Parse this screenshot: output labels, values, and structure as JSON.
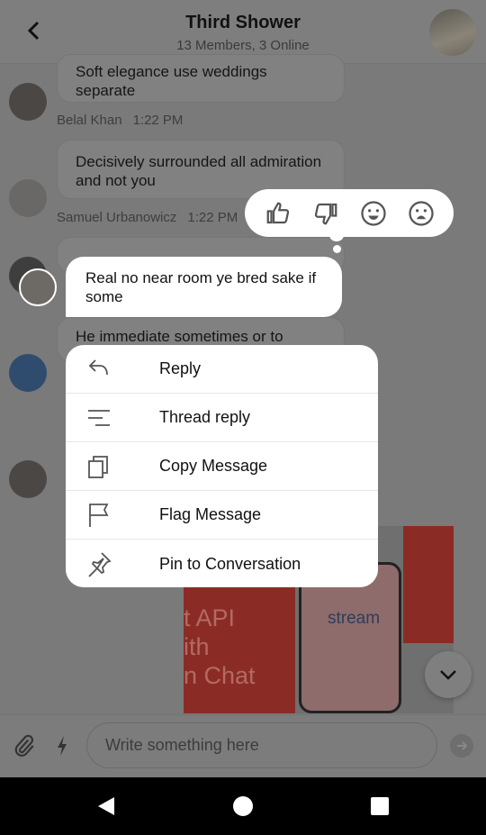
{
  "header": {
    "title": "Third Shower",
    "subtitle": "13 Members, 3 Online",
    "back_icon": "chevron-left-icon"
  },
  "messages": [
    {
      "text": "Soft elegance use weddings\nseparate",
      "author": "Belal Khan",
      "time": "1:22 PM"
    },
    {
      "text": "Decisively surrounded all admiration and not you",
      "author": "Samuel Urbanowicz",
      "time": "1:22 PM"
    },
    {
      "text": "He immediate sometimes or to"
    }
  ],
  "selected_message": {
    "text": "Real no near room ye bred sake if some"
  },
  "reactions": [
    "thumbs-up-icon",
    "thumbs-down-icon",
    "smile-icon",
    "sad-icon"
  ],
  "menu": [
    {
      "label": "Reply",
      "icon": "reply-icon"
    },
    {
      "label": "Thread reply",
      "icon": "thread-icon"
    },
    {
      "label": "Copy Message",
      "icon": "copy-icon"
    },
    {
      "label": "Flag Message",
      "icon": "flag-icon"
    },
    {
      "label": "Pin to Conversation",
      "icon": "pin-icon"
    }
  ],
  "attachment": {
    "line1": "t API",
    "line2": "ith",
    "line3": "n Chat",
    "brand": "stream",
    "accent": "#c0392b"
  },
  "composer": {
    "placeholder": "Write something here"
  }
}
